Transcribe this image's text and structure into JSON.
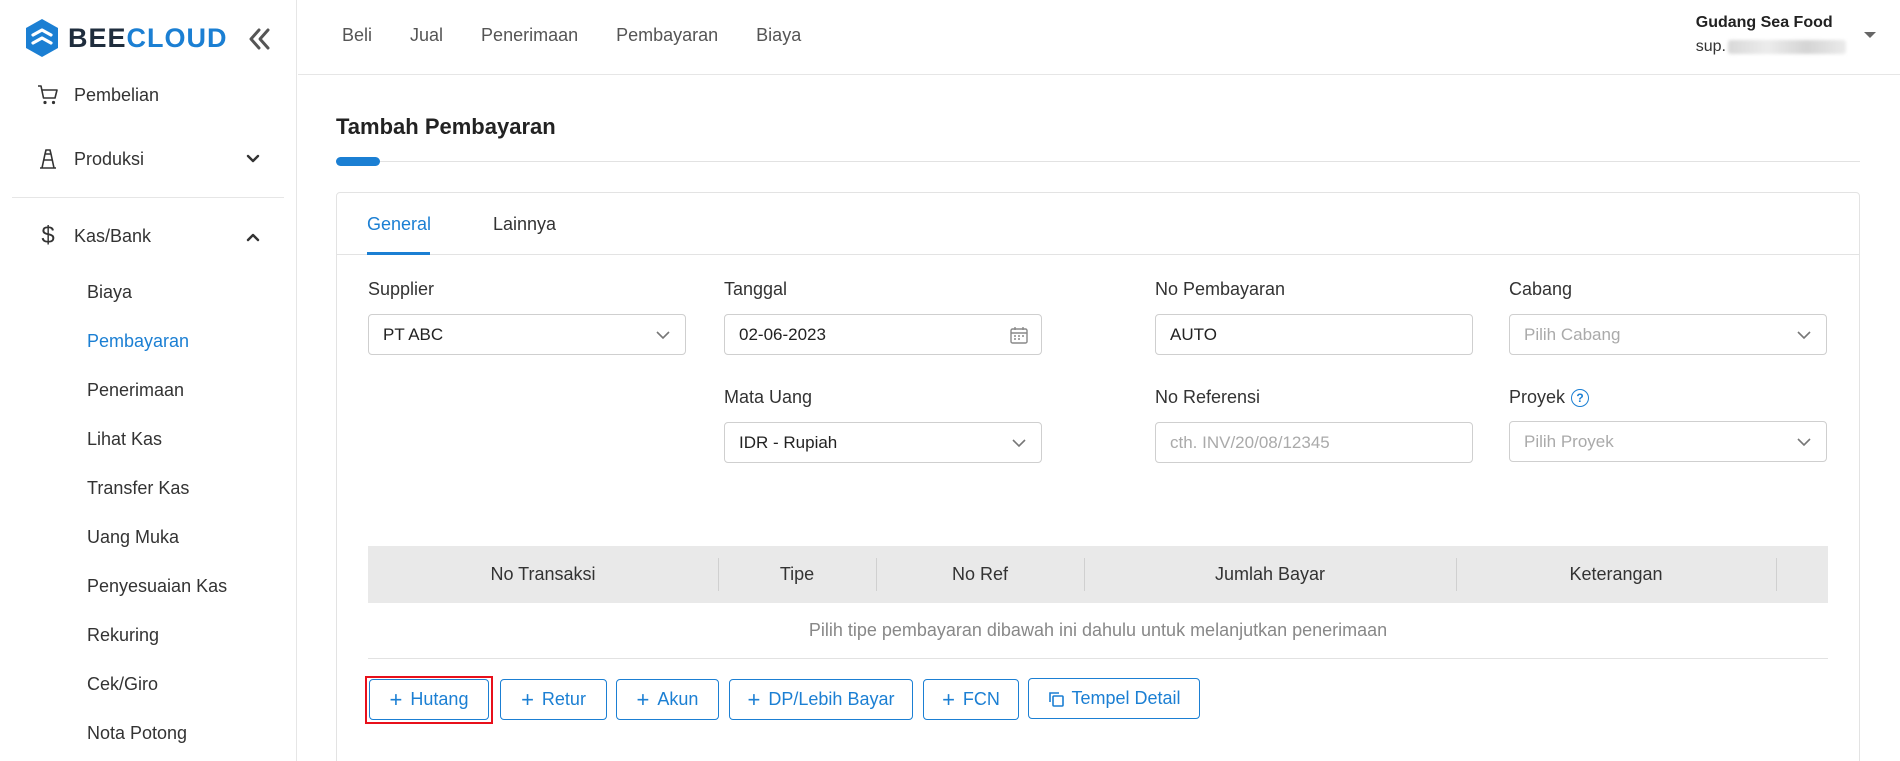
{
  "brand": {
    "part1": "BEE",
    "part2": "CLOUD"
  },
  "sidebar": {
    "items": [
      {
        "label": "Pembelian",
        "icon": "cart-icon"
      },
      {
        "label": "Produksi",
        "icon": "factory-icon"
      },
      {
        "label": "Kas/Bank",
        "icon": "dollar-icon"
      }
    ],
    "subitems": [
      {
        "label": "Biaya"
      },
      {
        "label": "Pembayaran",
        "active": true
      },
      {
        "label": "Penerimaan"
      },
      {
        "label": "Lihat Kas"
      },
      {
        "label": "Transfer Kas"
      },
      {
        "label": "Uang Muka"
      },
      {
        "label": "Penyesuaian Kas"
      },
      {
        "label": "Rekuring"
      },
      {
        "label": "Cek/Giro"
      },
      {
        "label": "Nota Potong"
      }
    ]
  },
  "topnav": {
    "items": [
      "Beli",
      "Jual",
      "Penerimaan",
      "Pembayaran",
      "Biaya"
    ]
  },
  "user": {
    "name": "Gudang Sea Food",
    "email_prefix": "sup."
  },
  "page": {
    "title": "Tambah Pembayaran"
  },
  "tabs": [
    {
      "label": "General",
      "active": true
    },
    {
      "label": "Lainnya"
    }
  ],
  "form": {
    "supplier": {
      "label": "Supplier",
      "value": "PT ABC"
    },
    "tanggal": {
      "label": "Tanggal",
      "value": "02-06-2023"
    },
    "no_pembayaran": {
      "label": "No Pembayaran",
      "value": "AUTO"
    },
    "cabang": {
      "label": "Cabang",
      "placeholder": "Pilih Cabang"
    },
    "mata_uang": {
      "label": "Mata Uang",
      "value": "IDR - Rupiah"
    },
    "no_referensi": {
      "label": "No Referensi",
      "placeholder": "cth. INV/20/08/12345"
    },
    "proyek": {
      "label": "Proyek",
      "placeholder": "Pilih Proyek"
    }
  },
  "table": {
    "columns": [
      "No Transaksi",
      "Tipe",
      "No Ref",
      "Jumlah Bayar",
      "Keterangan"
    ],
    "empty_message": "Pilih tipe pembayaran dibawah ini dahulu untuk melanjutkan penerimaan"
  },
  "actions": {
    "hutang": "Hutang",
    "retur": "Retur",
    "akun": "Akun",
    "dp": "DP/Lebih Bayar",
    "fcn": "FCN",
    "tempel": "Tempel Detail"
  },
  "colors": {
    "accent": "#1b7fd3",
    "highlight": "#e8101b",
    "brand_dark": "#1f2d3d"
  }
}
